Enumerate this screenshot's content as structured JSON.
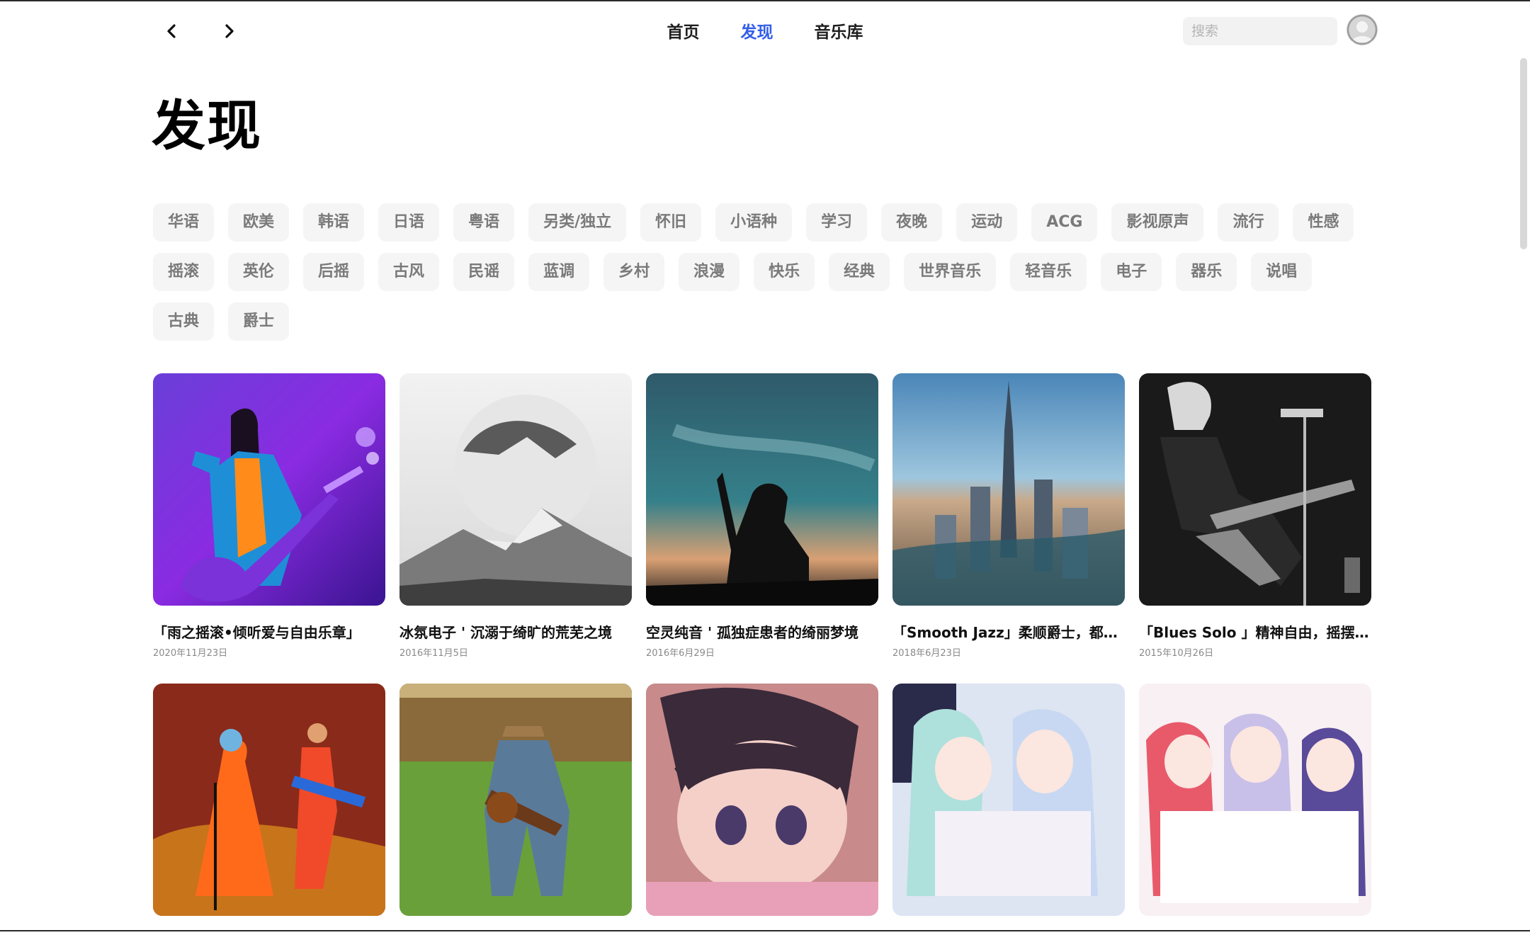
{
  "nav": {
    "back_icon": "chevron-left-icon",
    "forward_icon": "chevron-right-icon",
    "links": [
      {
        "label": "首页",
        "active": false
      },
      {
        "label": "发现",
        "active": true
      },
      {
        "label": "音乐库",
        "active": false
      }
    ],
    "search_placeholder": "搜索",
    "avatar_icon": "user-avatar-icon",
    "accent_color": "#335eea"
  },
  "page": {
    "title": "发现"
  },
  "categories": {
    "row1": [
      "华语",
      "欧美",
      "韩语",
      "日语",
      "粤语",
      "另类/独立",
      "怀旧",
      "小语种",
      "学习",
      "夜晚",
      "运动",
      "ACG",
      "影视原声",
      "流行",
      "性感"
    ],
    "row2": [
      "摇滚",
      "英伦",
      "后摇",
      "古风",
      "民谣",
      "蓝调",
      "乡村",
      "浪漫",
      "快乐",
      "经典",
      "世界音乐",
      "轻音乐",
      "电子",
      "器乐",
      "说唱"
    ],
    "row3": [
      "古典",
      "爵士"
    ]
  },
  "playlists": [
    {
      "title": "「雨之摇滚•倾听爱与自由乐章」",
      "date": "2020年11月23日"
    },
    {
      "title": "冰氛电子 ' 沉溺于绮旷的荒芜之境",
      "date": "2016年11月5日"
    },
    {
      "title": "空灵纯音 ' 孤独症患者的绮丽梦境",
      "date": "2016年6月29日"
    },
    {
      "title": "「Smooth Jazz」柔顺爵士，都市夜色下的慵懒情调",
      "date": "2018年6月23日"
    },
    {
      "title": "「Blues Solo 」精神自由，摇摆人生",
      "date": "2015年10月26日"
    },
    {
      "title": "",
      "date": ""
    },
    {
      "title": "",
      "date": ""
    },
    {
      "title": "",
      "date": ""
    },
    {
      "title": "",
      "date": ""
    },
    {
      "title": "",
      "date": ""
    }
  ]
}
